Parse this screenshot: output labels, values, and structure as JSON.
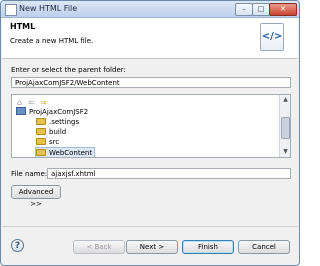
{
  "window": {
    "title": "New HTML File",
    "minimize": "–",
    "maximize": "□",
    "close": "✕"
  },
  "header": {
    "title": "HTML",
    "description": "Create a new HTML file.",
    "icon_label": "</>"
  },
  "parent_folder": {
    "label": "Enter or select the parent folder:",
    "value": "ProjAjaxComJSF2/WebContent"
  },
  "tree": {
    "nav_icons": [
      "home-icon",
      "back-icon",
      "forward-icon"
    ],
    "items": [
      {
        "label": "ProjAjaxComJSF2",
        "icon": "project-icon"
      },
      {
        "label": ".settings",
        "icon": "folder-icon"
      },
      {
        "label": "build",
        "icon": "folder-icon"
      },
      {
        "label": "src",
        "icon": "folder-icon"
      },
      {
        "label": "WebContent",
        "icon": "folder-icon",
        "selected": true
      }
    ]
  },
  "file_name": {
    "label": "File name:",
    "value": "ajaxjsf.xhtml"
  },
  "buttons": {
    "advanced": "Advanced >>",
    "back": "< Back",
    "next": "Next >",
    "finish": "Finish",
    "cancel": "Cancel",
    "help": "?"
  }
}
